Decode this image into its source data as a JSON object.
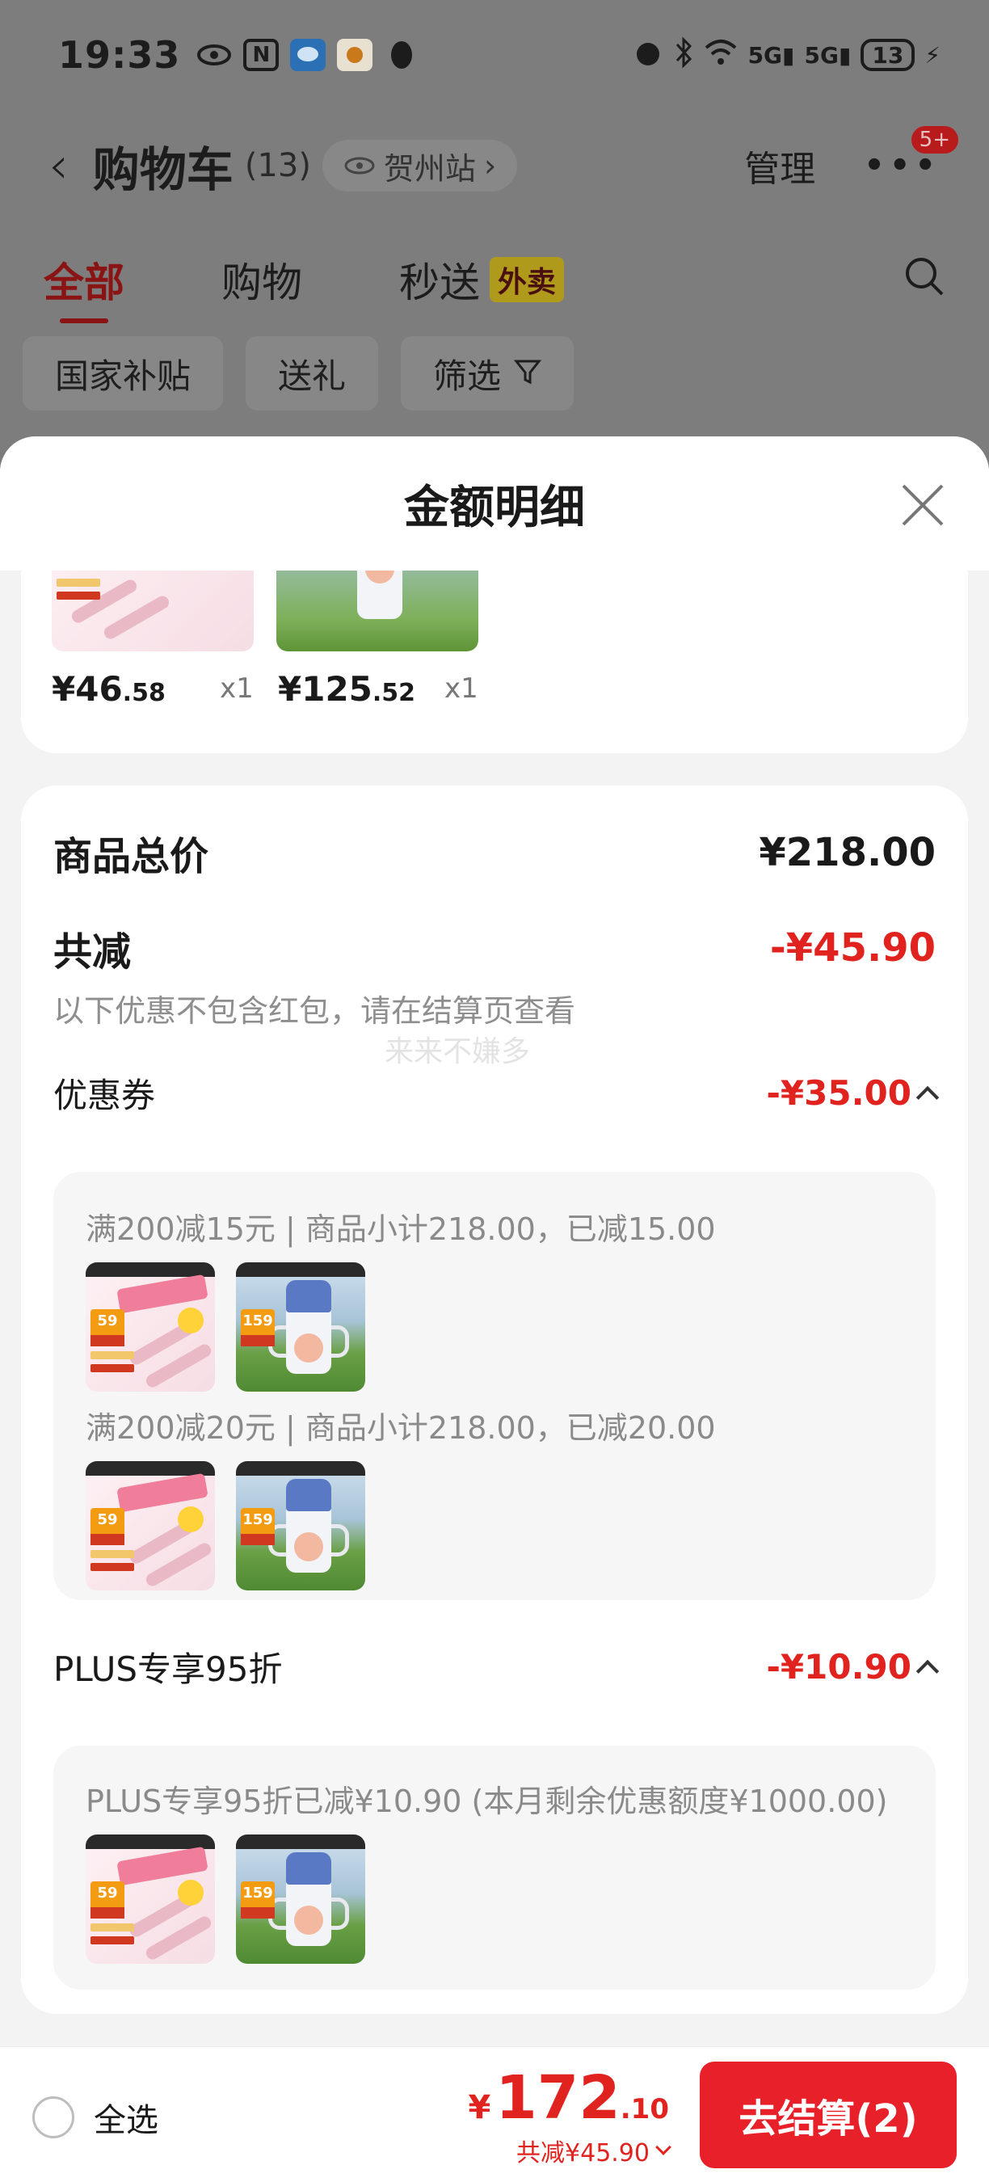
{
  "status_bar": {
    "time": "19:33",
    "battery": "13",
    "network1": "5G",
    "network2": "5G"
  },
  "nav": {
    "title": "购物车",
    "count": "(13)",
    "location": "贺州站",
    "manage": "管理",
    "badge": "5+"
  },
  "tabs": [
    {
      "label": "全部"
    },
    {
      "label": "购物"
    },
    {
      "label": "秒送"
    }
  ],
  "takeout_badge": "外卖",
  "chips": [
    {
      "label": "国家补贴"
    },
    {
      "label": "送礼"
    },
    {
      "label": "筛选"
    }
  ],
  "sheet": {
    "title": "金额明细",
    "items": [
      {
        "price_int": "¥46",
        "price_dec": ".58",
        "qty": "x1"
      },
      {
        "price_int": "¥125",
        "price_dec": ".52",
        "qty": "x1"
      }
    ],
    "total_label": "商品总价",
    "total_value": "¥218.00",
    "reduce_label": "共减",
    "reduce_value": "-¥45.90",
    "note": "以下优惠不包含红包，请在结算页查看",
    "watermark": "来来不嫌多",
    "coupon_label": "优惠券",
    "coupon_value": "-¥35.00",
    "coupon_lines": [
      "满200减15元 | 商品小计218.00，已减15.00",
      "满200减20元 | 商品小计218.00，已减20.00"
    ],
    "plus_label": "PLUS专享95折",
    "plus_value": "-¥10.90",
    "plus_line": "PLUS专享95折已减¥10.90 (本月剩余优惠额度¥1000.00)"
  },
  "thumb_prices": {
    "a": "59",
    "b": "159"
  },
  "bottom": {
    "select_all": "全选",
    "currency": "¥",
    "total_int": "172",
    "total_dec": ".10",
    "reduce_text": "共减¥45.90",
    "checkout": "去结算(2)"
  },
  "colors": {
    "accent": "#e0231e",
    "checkout": "#e8202a"
  }
}
